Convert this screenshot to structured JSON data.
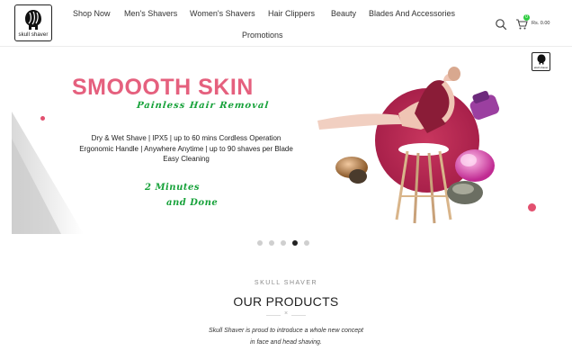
{
  "header": {
    "logo_text": "skull shaver",
    "nav": [
      {
        "label": "Shop Now"
      },
      {
        "label": "Men's Shavers"
      },
      {
        "label": "Women's Shavers"
      },
      {
        "label": "Hair Clippers"
      },
      {
        "label": "Beauty"
      },
      {
        "label": "Blades And Accessories"
      },
      {
        "label": "Promotions"
      }
    ],
    "cart_count": "0",
    "cart_total": "Rs. 0.00",
    "icons": [
      "search-icon",
      "cart-icon"
    ]
  },
  "banner": {
    "title": "SMOOOTH SKIN",
    "subtitle": "Painless Hair Removal",
    "features": [
      "Dry & Wet Shave  |  IPX5  |  up to 60 mins Cordless Operation",
      "Ergonomic Handle  |  Anywhere Anytime  |  up to 90 shaves per Blade",
      "Easy Cleaning"
    ],
    "tagline_1": "2 Minutes",
    "tagline_2": "and Done",
    "logo_text": "skull shaver",
    "colors": {
      "title": "#e5607e",
      "accent_green": "#17a23a",
      "pink_dot": "#e2506f"
    }
  },
  "slider": {
    "count": 5,
    "active_index": 3
  },
  "products": {
    "eyebrow": "SKULL SHAVER",
    "heading": "OUR PRODUCTS",
    "divider_symbol": "×",
    "description_1": "Skull Shaver is proud to introduce a whole new concept",
    "description_2": "in face and head shaving."
  }
}
